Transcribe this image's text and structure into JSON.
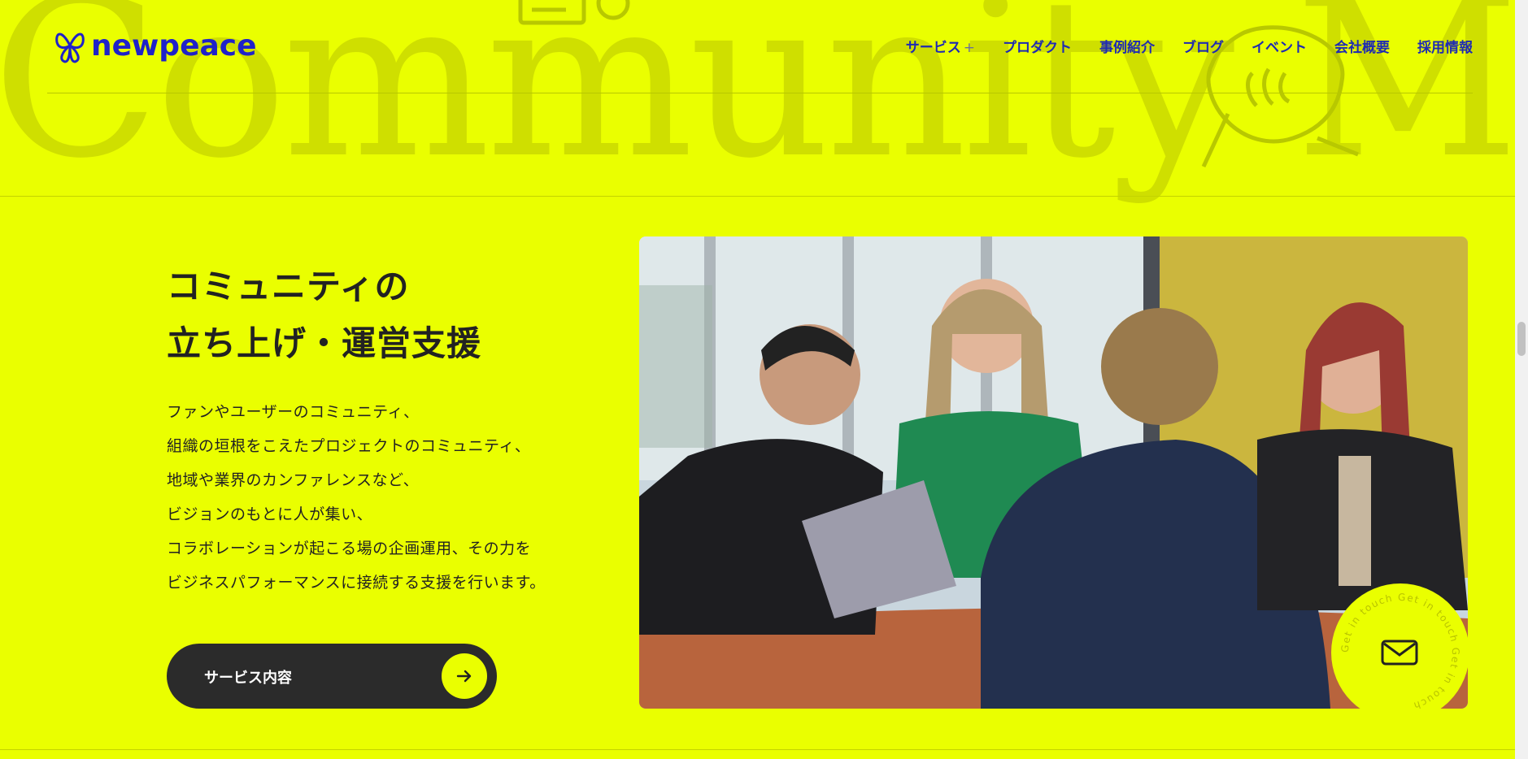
{
  "brand": {
    "logo_text": "newpeace",
    "color": "#1f22c9"
  },
  "background_word": "Community M",
  "nav": {
    "items": [
      {
        "label": "サービス",
        "suffix": "+"
      },
      {
        "label": "プロダクト"
      },
      {
        "label": "事例紹介"
      },
      {
        "label": "ブログ"
      },
      {
        "label": "イベント"
      },
      {
        "label": "会社概要"
      },
      {
        "label": "採用情報"
      }
    ]
  },
  "section": {
    "heading_line1": "コミュニティの",
    "heading_line2": "立ち上げ・運営支援",
    "body_lines": [
      "ファンやユーザーのコミュニティ、",
      "組織の垣根をこえたプロジェクトのコミュニティ、",
      "地域や業界のカンファレンスなど、",
      "ビジョンのもとに人が集い、",
      "コラボレーションが起こる場の企画運用、その力を",
      "ビジネスパフォーマンスに接続する支援を行います。"
    ],
    "cta_label": "サービス内容"
  },
  "contact_badge": {
    "ring_text": "Get in touch Get in touch Get in touch ",
    "icon": "mail-icon"
  },
  "colors": {
    "accent": "#eaff00",
    "dark": "#2b2b2b",
    "nav": "#1e2ab3"
  }
}
